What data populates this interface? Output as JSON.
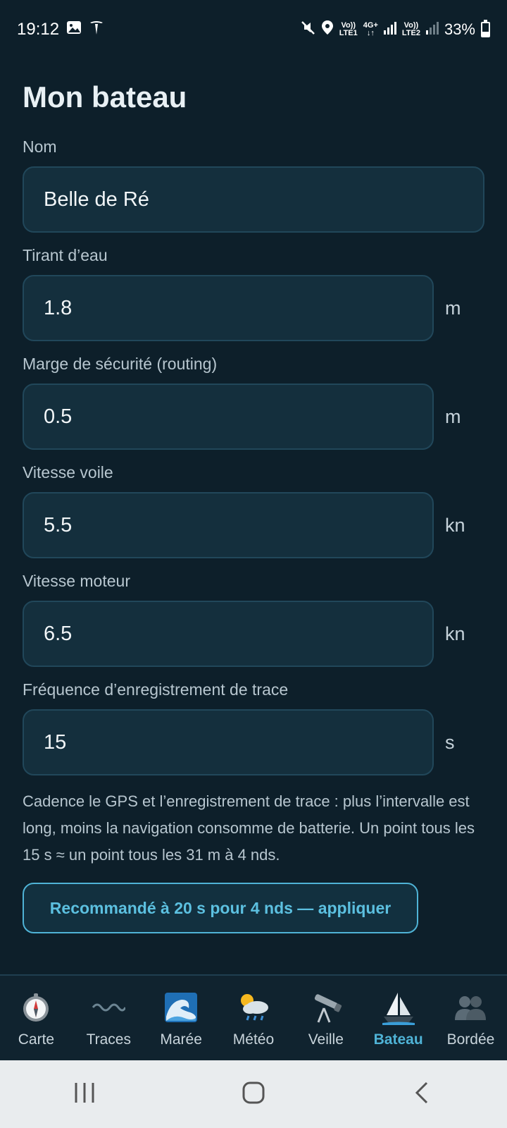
{
  "status_bar": {
    "time": "19:12",
    "sim1_top": "Vo))",
    "sim1_bottom": "LTE1",
    "net_top": "4G+",
    "net_bottom": "↓↑",
    "sim2_top": "Vo))",
    "sim2_bottom": "LTE2",
    "battery": "33%",
    "battery_level": 0.33,
    "icons": [
      "image-icon",
      "tesla-icon",
      "mute-icon",
      "location-icon",
      "signal-icon",
      "battery-icon"
    ]
  },
  "page": {
    "title": "Mon bateau"
  },
  "fields": {
    "name": {
      "label": "Nom",
      "value": "Belle de Ré"
    },
    "draft": {
      "label": "Tirant d’eau",
      "value": "1.8",
      "unit": "m"
    },
    "safety_margin": {
      "label": "Marge de sécurité (routing)",
      "value": "0.5",
      "unit": "m"
    },
    "sail_speed": {
      "label": "Vitesse voile",
      "value": "5.5",
      "unit": "kn"
    },
    "motor_speed": {
      "label": "Vitesse moteur",
      "value": "6.5",
      "unit": "kn"
    },
    "track_frequency": {
      "label": "Fréquence d’enregistrement de trace",
      "value": "15",
      "unit": "s"
    }
  },
  "help_text": "Cadence le GPS et l’enregistrement de trace : plus l’intervalle est long, moins la navigation consomme de batterie. Un point tous les 15 s ≈ un point tous les 31 m à 4 nds.",
  "recommend_button": "Recommandé à 20 s pour 4 nds — appliquer",
  "bottom_nav": [
    {
      "label": "Carte",
      "icon": "compass-icon",
      "active": false
    },
    {
      "label": "Traces",
      "icon": "wave-line-icon",
      "active": false
    },
    {
      "label": "Marée",
      "icon": "water-wave-icon",
      "active": false
    },
    {
      "label": "Météo",
      "icon": "weather-icon",
      "active": false
    },
    {
      "label": "Veille",
      "icon": "telescope-icon",
      "active": false
    },
    {
      "label": "Bateau",
      "icon": "sailboat-icon",
      "active": true
    },
    {
      "label": "Bordée",
      "icon": "crew-icon",
      "active": false
    }
  ],
  "colors": {
    "background": "#0d1f2a",
    "input_bg": "#142f3d",
    "accent": "#4fb3d6"
  }
}
